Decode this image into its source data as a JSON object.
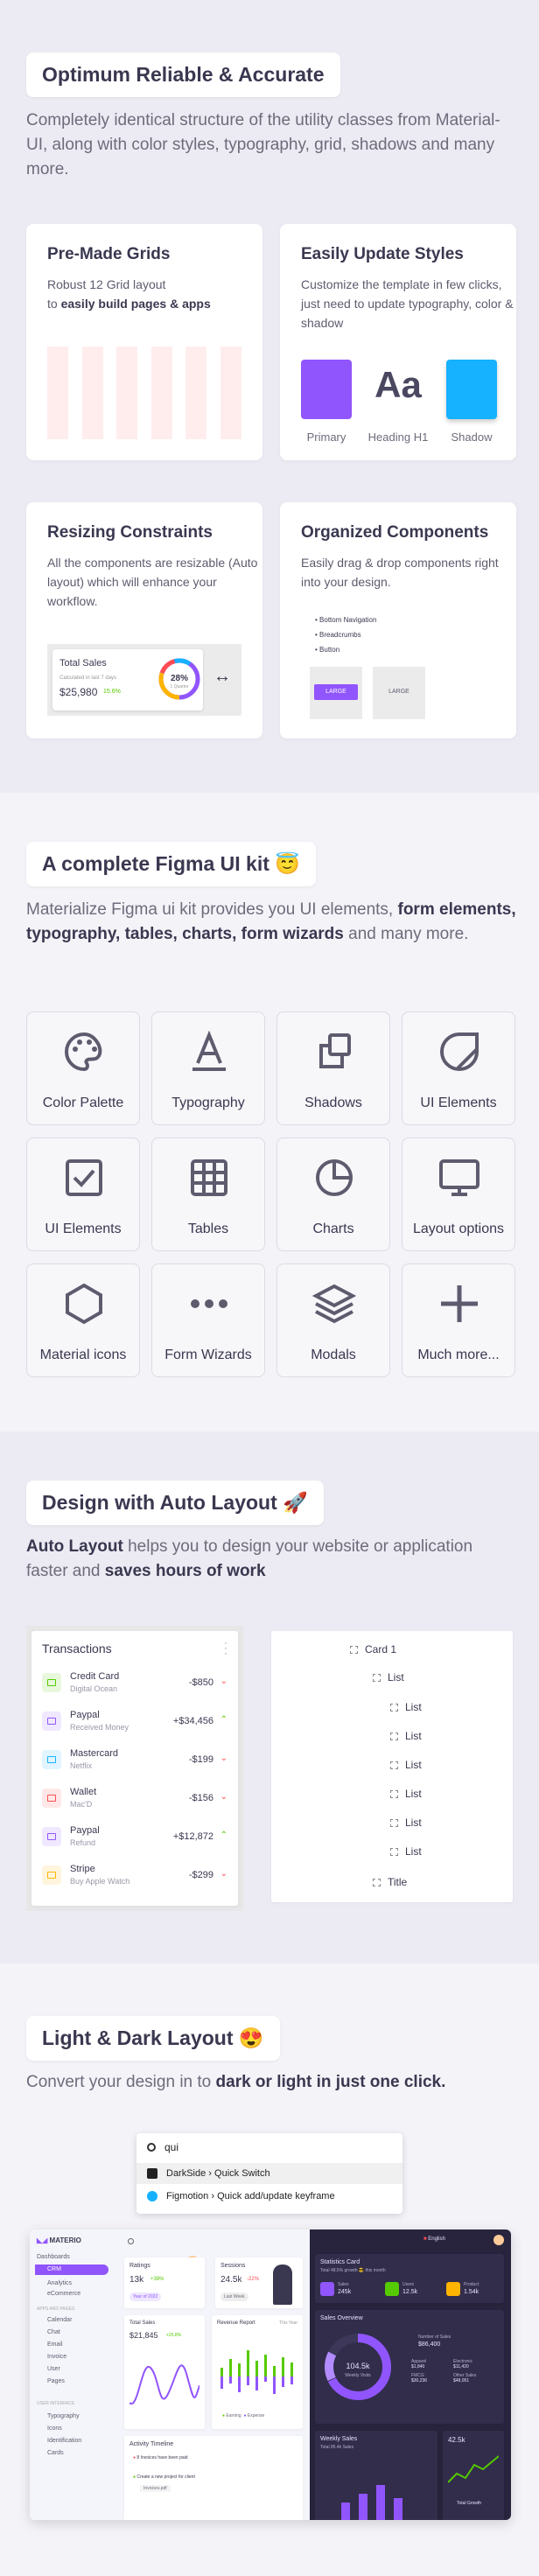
{
  "s1": {
    "title": "Optimum Reliable & Accurate",
    "lead": "Completely identical structure of the utility classes from Material-UI, along with color styles, typography, grid, shadows and many more.",
    "grids": {
      "title": "Pre-Made Grids",
      "text": "Robust 12 Grid layout",
      "text_to": "to",
      "text_bold": "easily build pages & apps"
    },
    "styles": {
      "title": "Easily Update Styles",
      "text": "Customize the template in few clicks, just need to update typography, color & shadow",
      "aa": "Aa",
      "labels": [
        "Primary",
        "Heading H1",
        "Shadow"
      ],
      "colors": {
        "primary": "#9155fd",
        "shadow": "#16b1ff"
      }
    },
    "resize": {
      "title": "Resizing Constraints",
      "text": "All the components are resizable (Auto layout) which will enhance your workflow.",
      "widget_title": "Total Sales",
      "widget_sub": "Calculated in last 7 days",
      "widget_value": "$25,980",
      "widget_change": "15.6%",
      "donut_value": "28%",
      "donut_label": "1 Quarter",
      "arrow": "↔"
    },
    "organized": {
      "title": "Organized Components",
      "text": "Easily drag & drop components right into your design.",
      "bullets": [
        "Bottom Navigation",
        "Breadcrumbs",
        "Button"
      ],
      "btn_large": "LARGE",
      "btn_large2": "LARGE"
    }
  },
  "s2": {
    "title": "A complete Figma UI kit",
    "emoji": "😇",
    "lead_pre": "Materialize Figma ui kit provides you UI elements, ",
    "lead_bold": "form elements, typography, tables, charts, form wizards",
    "lead_post": " and many more.",
    "tiles": [
      {
        "label": "Color Palette",
        "icon": "palette-icon"
      },
      {
        "label": "Typography",
        "icon": "typography-icon"
      },
      {
        "label": "Shadows",
        "icon": "shadows-icon"
      },
      {
        "label": "UI Elements",
        "icon": "ui-elements-icon"
      },
      {
        "label": "UI Elements",
        "icon": "checkbox-icon"
      },
      {
        "label": "Tables",
        "icon": "table-icon"
      },
      {
        "label": "Charts",
        "icon": "pie-chart-icon"
      },
      {
        "label": "Layout options",
        "icon": "monitor-icon"
      },
      {
        "label": "Material icons",
        "icon": "hexagon-icon"
      },
      {
        "label": "Form Wizards",
        "icon": "dots-icon"
      },
      {
        "label": "Modals",
        "icon": "layers-icon"
      },
      {
        "label": "Much more...",
        "icon": "plus-icon"
      }
    ]
  },
  "s3": {
    "title": "Design with Auto Layout",
    "emoji": "🚀",
    "lead_bold1": "Auto Layout",
    "lead_mid": " helps you to design your website or application faster and ",
    "lead_bold2": "saves hours of work",
    "transactions": {
      "title": "Transactions",
      "rows": [
        {
          "name": "Credit Card",
          "sub": "Digital Ocean",
          "amount": "-$850",
          "dir": "down",
          "color": "#56ca00"
        },
        {
          "name": "Paypal",
          "sub": "Received Money",
          "amount": "+$34,456",
          "dir": "up",
          "color": "#9155fd"
        },
        {
          "name": "Mastercard",
          "sub": "Netflix",
          "amount": "-$199",
          "dir": "down",
          "color": "#16b1ff"
        },
        {
          "name": "Wallet",
          "sub": "Mac'D",
          "amount": "-$156",
          "dir": "down",
          "color": "#ff4c51"
        },
        {
          "name": "Paypal",
          "sub": "Refund",
          "amount": "+$12,872",
          "dir": "up",
          "color": "#9155fd"
        },
        {
          "name": "Stripe",
          "sub": "Buy Apple Watch",
          "amount": "-$299",
          "dir": "down",
          "color": "#ffb400"
        }
      ]
    },
    "layers": {
      "card": "Card 1",
      "list": "List",
      "items": [
        "List",
        "List",
        "List",
        "List",
        "List",
        "List"
      ],
      "title": "Title"
    }
  },
  "s4": {
    "title": "Light & Dark Layout",
    "emoji": "😍",
    "lead_pre": "Convert your design in to ",
    "lead_bold": "dark or light in just one click.",
    "search": {
      "query": "qui",
      "results": [
        {
          "text": "DarkSide › Quick Switch"
        },
        {
          "text": "Figmotion › Quick add/update keyframe"
        }
      ]
    },
    "dash": {
      "brand": "MATERIO",
      "nav": [
        "Dashboards",
        "CRM",
        "Analytics",
        "eCommerce"
      ],
      "nav2_head": "APPS AND PAGES",
      "nav2": [
        "Calendar",
        "Chat",
        "Email",
        "Invoice",
        "User",
        "Pages"
      ],
      "nav3_head": "USER INTERFACE",
      "nav3": [
        "Typography",
        "Icons",
        "Identification",
        "Cards"
      ],
      "ratings": {
        "title": "Ratings",
        "value": "13k",
        "change": "+38%",
        "badge": "Year of 2022"
      },
      "sessions": {
        "title": "Sessions",
        "value": "24.5k",
        "change": "-22%",
        "badge": "Last Week"
      },
      "total_sales": {
        "title": "Total Sales",
        "value": "$21,845",
        "change": "+25.8%"
      },
      "revenue": {
        "title": "Revenue Report",
        "tab": "This Year",
        "legend": [
          "Earning",
          "Expense"
        ]
      },
      "activity": {
        "title": "Activity Timeline",
        "items": [
          "8 Invoices have been paid",
          "Create a new project for client",
          "Invoices.pdf"
        ]
      },
      "stats": {
        "title": "Statistics Card",
        "sub": "Total 48.5% growth 😎 this month",
        "items": [
          {
            "l": "Sales",
            "v": "245k"
          },
          {
            "l": "Users",
            "v": "12.5k"
          },
          {
            "l": "Product",
            "v": "1.54k"
          }
        ]
      },
      "overview": {
        "title": "Sales Overview",
        "center": "104.5k",
        "center_sub": "Weekly Visits",
        "num_label": "Number of Sales",
        "num_value": "$86,400",
        "cells": [
          {
            "l": "Apparel",
            "v": "$1,840"
          },
          {
            "l": "Electronic",
            "v": "$11,420"
          },
          {
            "l": "FMCG",
            "v": "$30,236"
          },
          {
            "l": "Other Sales",
            "v": "$48,051"
          }
        ]
      },
      "weekly": {
        "title": "Weekly Sales",
        "sub": "Total 85.4k Sales"
      },
      "profit": {
        "value": "42.5k",
        "sub": "Total Growth"
      },
      "lang": "English"
    }
  }
}
